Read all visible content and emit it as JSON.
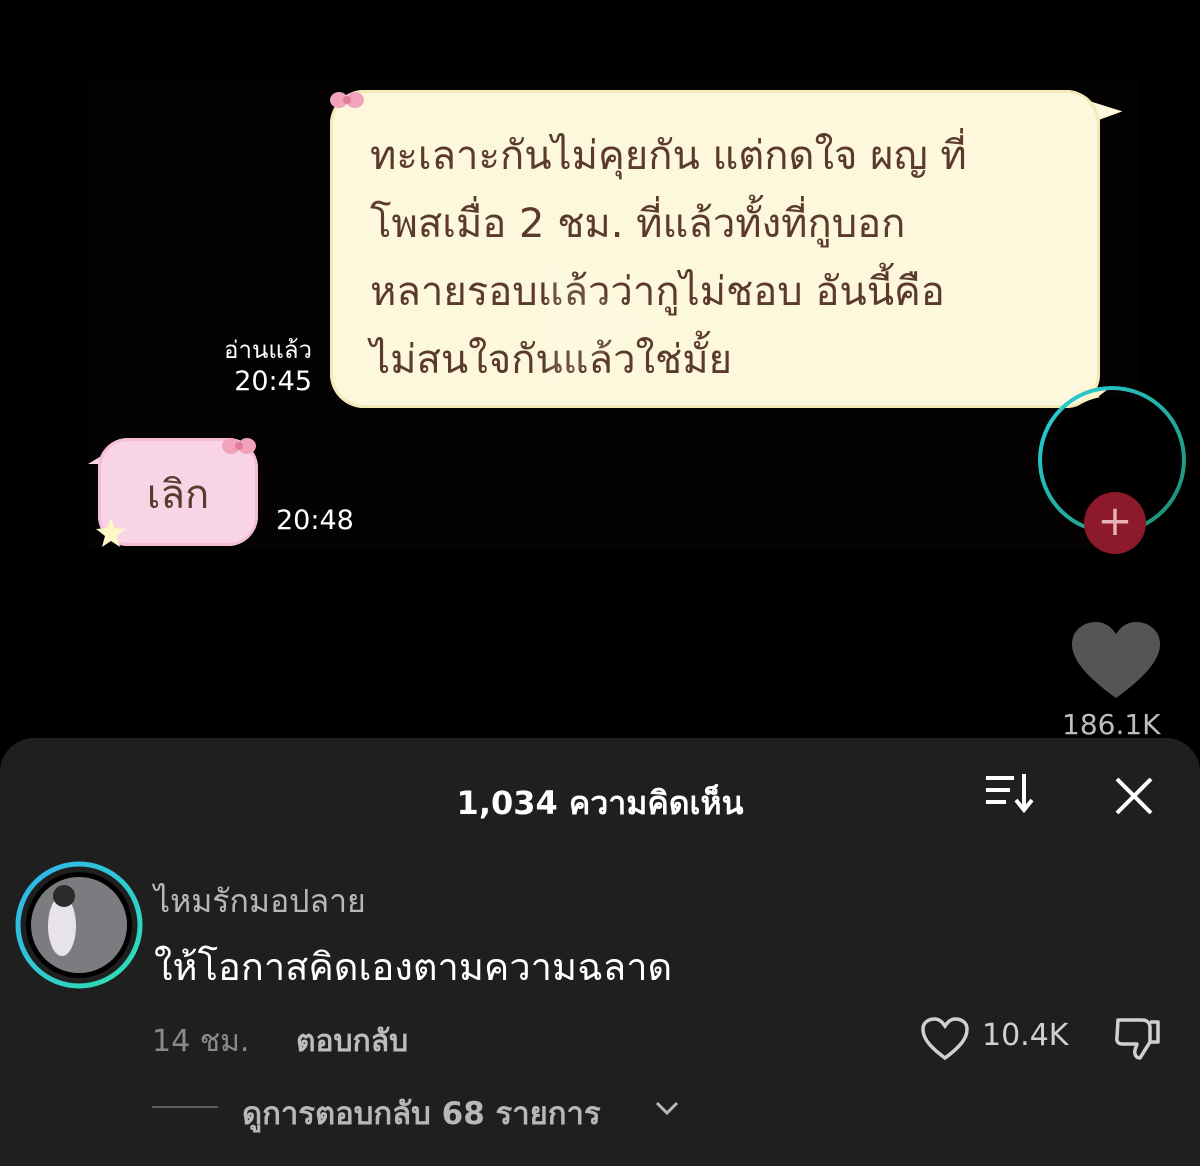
{
  "chat": {
    "outgoing_message": "ทะเลาะกันไม่คุยกัน แต่กดใจ ผญ ที่\nโพสเมื่อ 2 ชม. ที่แล้วทั้งที่กูบอก\nหลายรอบแล้วว่ากูไม่ชอบ อันนี้คือ\nไม่สนใจกันแล้วใช่มั้ย",
    "read_label": "อ่านแล้ว",
    "read_time": "20:45",
    "incoming_message": "เลิก",
    "incoming_time": "20:48"
  },
  "side_actions": {
    "like_count": "186.1K",
    "follow_icon": "plus-icon"
  },
  "comments": {
    "title": "1,034 ความคิดเห็น",
    "sort_icon": "sort-icon",
    "close_icon": "close-icon",
    "items": [
      {
        "username": "ไหมรักมอปลาย",
        "text": "ให้โอกาสคิดเองตามความฉลาด",
        "time": "14 ชม.",
        "reply_label": "ตอบกลับ",
        "like_count": "10.4K",
        "view_replies": "ดูการตอบกลับ 68 รายการ"
      }
    ]
  },
  "colors": {
    "outgoing_bubble": "#fdf7dc",
    "incoming_bubble": "#f9d4e6",
    "panel_bg": "#1f1f1f",
    "follow_button": "#8c1a2a"
  }
}
